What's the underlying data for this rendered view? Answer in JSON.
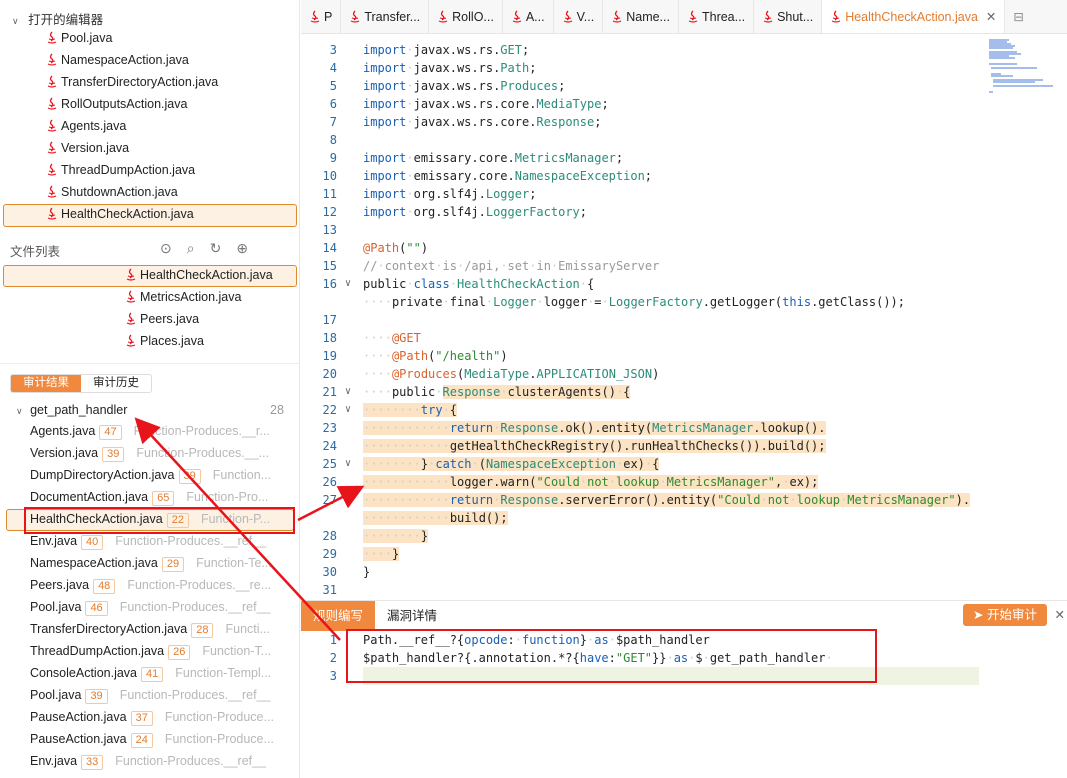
{
  "sidebar": {
    "open_editors_title": "打开的编辑器",
    "open_files": [
      "Pool.java",
      "NamespaceAction.java",
      "TransferDirectoryAction.java",
      "RollOutputsAction.java",
      "Agents.java",
      "Version.java",
      "ThreadDumpAction.java",
      "ShutdownAction.java",
      "HealthCheckAction.java"
    ],
    "file_list_title": "文件列表",
    "tree_files": [
      "HealthCheckAction.java",
      "MetricsAction.java",
      "Peers.java",
      "Places.java"
    ],
    "tabs": [
      "审计结果",
      "审计历史"
    ],
    "group": {
      "label": "get_path_handler",
      "count": "28"
    },
    "results": [
      {
        "file": "Agents.java",
        "line": "47",
        "func": "Function-Produces.__r..."
      },
      {
        "file": "Version.java",
        "line": "39",
        "func": "Function-Produces.__..."
      },
      {
        "file": "DumpDirectoryAction.java",
        "line": "39",
        "func": "Function..."
      },
      {
        "file": "DocumentAction.java",
        "line": "65",
        "func": "Function-Pro..."
      },
      {
        "file": "HealthCheckAction.java",
        "line": "22",
        "func": "Function-P..."
      },
      {
        "file": "Env.java",
        "line": "40",
        "func": "Function-Produces.__ref__"
      },
      {
        "file": "NamespaceAction.java",
        "line": "29",
        "func": "Function-Te..."
      },
      {
        "file": "Peers.java",
        "line": "48",
        "func": "Function-Produces.__re..."
      },
      {
        "file": "Pool.java",
        "line": "46",
        "func": "Function-Produces.__ref__"
      },
      {
        "file": "TransferDirectoryAction.java",
        "line": "28",
        "func": "Functi..."
      },
      {
        "file": "ThreadDumpAction.java",
        "line": "26",
        "func": "Function-T..."
      },
      {
        "file": "ConsoleAction.java",
        "line": "41",
        "func": "Function-Templ..."
      },
      {
        "file": "Pool.java",
        "line": "39",
        "func": "Function-Produces.__ref__"
      },
      {
        "file": "PauseAction.java",
        "line": "37",
        "func": "Function-Produce..."
      },
      {
        "file": "PauseAction.java",
        "line": "24",
        "func": "Function-Produce..."
      },
      {
        "file": "Env.java",
        "line": "33",
        "func": "Function-Produces.__ref__"
      }
    ]
  },
  "editor": {
    "tabs": [
      "P",
      "Transfer...",
      "RollO...",
      "A...",
      "V...",
      "Name...",
      "Threa...",
      "Shut...",
      "HealthCheckAction.java"
    ],
    "lines": [
      {
        "n": "3",
        "html": "<span class='kw'>import</span>·javax.ws.rs.<span class='ty'>GET</span>;"
      },
      {
        "n": "4",
        "html": "<span class='kw'>import</span>·javax.ws.rs.<span class='ty'>Path</span>;"
      },
      {
        "n": "5",
        "html": "<span class='kw'>import</span>·javax.ws.rs.<span class='ty'>Produces</span>;"
      },
      {
        "n": "6",
        "html": "<span class='kw'>import</span>·javax.ws.rs.core.<span class='ty'>MediaType</span>;"
      },
      {
        "n": "7",
        "html": "<span class='kw'>import</span>·javax.ws.rs.core.<span class='ty'>Response</span>;"
      },
      {
        "n": "8",
        "html": ""
      },
      {
        "n": "9",
        "html": "<span class='kw'>import</span>·emissary.core.<span class='ty'>MetricsManager</span>;"
      },
      {
        "n": "10",
        "html": "<span class='kw'>import</span>·emissary.core.<span class='ty'>NamespaceException</span>;"
      },
      {
        "n": "11",
        "html": "<span class='kw'>import</span>·org.slf4j.<span class='ty'>Logger</span>;"
      },
      {
        "n": "12",
        "html": "<span class='kw'>import</span>·org.slf4j.<span class='ty'>LoggerFactory</span>;"
      },
      {
        "n": "13",
        "html": ""
      },
      {
        "n": "14",
        "html": "<span class='an'>@Path</span>(<span class='st'>\"\"</span>)"
      },
      {
        "n": "15",
        "html": "<span class='cm'>//·context·is·/api,·set·in·EmissaryServer</span>"
      },
      {
        "n": "16",
        "html": "public·<span class='kw'>class</span>·<span class='ty'>HealthCheckAction</span>·{",
        "fold": true
      },
      {
        "n": "",
        "html": "····private·final·<span class='ty'>Logger</span>·logger·=·<span class='ty'>LoggerFactory</span>.getLogger(<span class='kw'>this</span>.getClass());"
      },
      {
        "n": "17",
        "html": ""
      },
      {
        "n": "18",
        "html": "····<span class='an'>@GET</span>"
      },
      {
        "n": "19",
        "html": "····<span class='an'>@Path</span>(<span class='st'>\"/health\"</span>)"
      },
      {
        "n": "20",
        "html": "····<span class='an'>@Produces</span>(<span class='ty'>MediaType</span>.<span class='ty'>APPLICATION_JSON</span>)"
      },
      {
        "n": "21",
        "html": "····public·<span class='orange'><span class='ty'>Response</span>·clusterAgents()·{</span>",
        "fold": true
      },
      {
        "n": "22",
        "html": "<span class='orange'>········<span class='kw'>try</span>·{</span>",
        "fold": true
      },
      {
        "n": "23",
        "html": "<span class='orange'>············<span class='kw'>return</span>·<span class='ty'>Response</span>.ok().entity(<span class='ty'>MetricsManager</span>.lookup().</span>"
      },
      {
        "n": "24",
        "html": "<span class='orange'>············getHealthCheckRegistry().runHealthChecks()).build();</span>"
      },
      {
        "n": "25",
        "html": "<span class='orange'>········}·<span class='kw'>catch</span>·(<span class='ty'>NamespaceException</span>·ex)·{</span>",
        "fold": true
      },
      {
        "n": "26",
        "html": "<span class='orange'>············logger.warn(<span class='st'>\"Could·not·lookup·MetricsManager\"</span>,·ex);</span>"
      },
      {
        "n": "27",
        "html": "<span class='orange'>············<span class='kw'>return</span>·<span class='ty'>Response</span>.serverError().entity(<span class='st'>\"Could·not·lookup·MetricsManager\"</span>).</span>"
      },
      {
        "n": "",
        "html": "<span class='orange'>············build();</span>"
      },
      {
        "n": "28",
        "html": "<span class='orange'>········}</span>"
      },
      {
        "n": "29",
        "html": "<span class='orange'>····}</span>"
      },
      {
        "n": "30",
        "html": "}"
      },
      {
        "n": "31",
        "html": ""
      }
    ]
  },
  "rule_panel": {
    "tabs": [
      "规则编写",
      "漏洞详情"
    ],
    "start_button": "开始审计",
    "lines": [
      {
        "n": "1",
        "html": "Path.__ref__?{<span class='kw'>opcode</span>:·<span class='kw'>function</span>}·<span class='kw'>as</span>·$path_handler"
      },
      {
        "n": "2",
        "html": "$path_handler?{.annotation.*?{<span class='kw'>have</span>:<span class='st'>\"GET\"</span>}}·<span class='kw'>as</span>·$·get_path_handler·"
      },
      {
        "n": "3",
        "html": ""
      }
    ]
  }
}
